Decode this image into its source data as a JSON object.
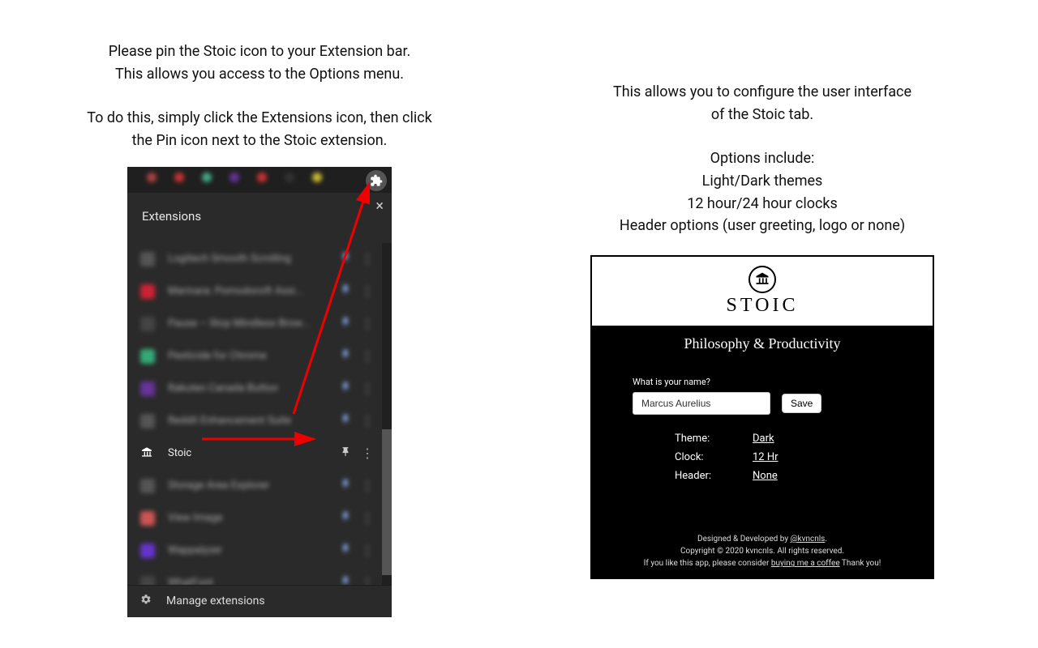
{
  "left": {
    "p1a": "Please pin the Stoic icon to your Extension bar.",
    "p1b": "This allows you access to the Options menu.",
    "p2a": "To do this, simply click the Extensions icon, then click",
    "p2b": "the Pin icon next to the Stoic extension.",
    "ext_popup": {
      "title": "Extensions",
      "close": "×",
      "items": [
        {
          "label": "Logitech Smooth Scrolling",
          "color": "#555"
        },
        {
          "label": "Marinara: Pomodoro® Assi...",
          "color": "#c23"
        },
        {
          "label": "Pause – Stop Mindless Brow...",
          "color": "#444"
        },
        {
          "label": "Pesticide for Chrome",
          "color": "#3a7"
        },
        {
          "label": "Rakuten Canada Button",
          "color": "#639"
        },
        {
          "label": "Reddit Enhancement Suite",
          "color": "#555"
        },
        {
          "label": "Stoic",
          "color": "#fff",
          "focus": true
        },
        {
          "label": "Storage Area Explorer",
          "color": "#555"
        },
        {
          "label": "View Image",
          "color": "#c55"
        },
        {
          "label": "Wappalyzer",
          "color": "#63c"
        },
        {
          "label": "WhatFont",
          "color": "#444"
        }
      ],
      "footer": "Manage extensions"
    }
  },
  "right": {
    "p1a": "This allows you to configure the user interface",
    "p1b": "of the Stoic tab.",
    "p2": "Options include:",
    "p3": "Light/Dark themes",
    "p4": "12 hour/24 hour clocks",
    "p5": "Header options (user greeting, logo or none)",
    "options_panel": {
      "brand": "STOIC",
      "subtitle": "Philosophy & Productivity",
      "name_label": "What is your name?",
      "name_value": "Marcus Aurelius",
      "save_label": "Save",
      "settings": [
        {
          "k": "Theme:",
          "v": "Dark"
        },
        {
          "k": "Clock:",
          "v": "12 Hr"
        },
        {
          "k": "Header:",
          "v": "None"
        }
      ],
      "credits": {
        "line1_prefix": "Designed & Developed by ",
        "line1_link": "@kvncnls",
        "line1_suffix": ".",
        "line2": "Copyright © 2020 kvncnls. All rights reserved.",
        "line3_prefix": "If you like this app, please consider ",
        "line3_link": "buying me a coffee",
        "line3_suffix": " Thank you!"
      }
    }
  }
}
